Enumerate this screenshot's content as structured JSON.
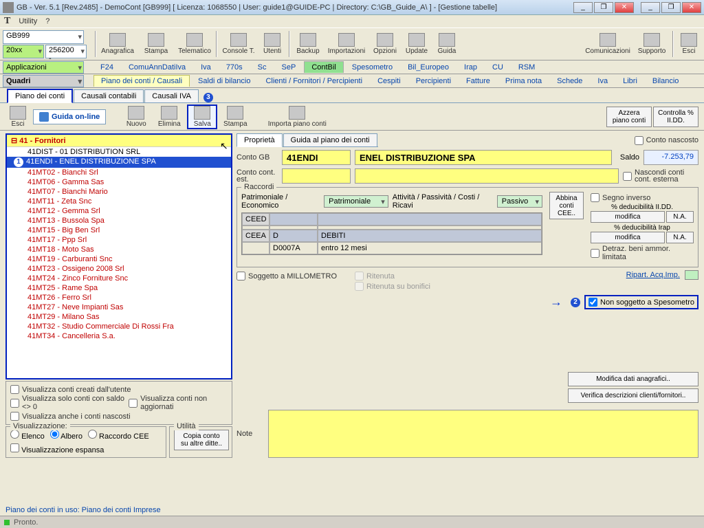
{
  "window": {
    "title": "GB - Ver. 5.1 [Rev.2485] -  DemoCont [GB999]    [ Licenza: 1068550 | User: guide1@GUIDE-PC | Directory: C:\\GB_Guide_A\\ ] - [Gestione tabelle]"
  },
  "menubar": {
    "utility": "Utility",
    "help": "?"
  },
  "leftcombos": {
    "ditta": "GB999",
    "anno": "20xx",
    "code": "256200 -",
    "applicazioni": "Applicazioni",
    "quadri": "Quadri"
  },
  "maintoolbar": {
    "anagrafica": "Anagrafica",
    "stampa": "Stampa",
    "telematico": "Telematico",
    "consolet": "Console T.",
    "utenti": "Utenti",
    "backup": "Backup",
    "importazioni": "Importazioni",
    "opzioni": "Opzioni",
    "update": "Update",
    "guida": "Guida",
    "comunicazioni": "Comunicazioni",
    "supporto": "Supporto",
    "esci": "Esci"
  },
  "tabrow1": {
    "items": [
      "F24",
      "ComuAnnDatiIva",
      "Iva",
      "770s",
      "Sc",
      "SeP",
      "ContBil",
      "Spesometro",
      "Bil_Europeo",
      "Irap",
      "CU",
      "RSM"
    ],
    "active": "ContBil"
  },
  "tabrow2": {
    "lead": "Piano dei conti / Causali",
    "items": [
      "Saldi di bilancio",
      "Clienti / Fornitori / Percipienti",
      "Cespiti",
      "Percipienti",
      "Fatture",
      "Prima nota",
      "Schede",
      "Iva",
      "Libri",
      "Bilancio"
    ]
  },
  "subtabs": {
    "t1": "Piano dei conti",
    "t2": "Causali contabili",
    "t3": "Causali IVA"
  },
  "toolbar2": {
    "esci": "Esci",
    "guida_online": "Guida on-line",
    "nuovo": "Nuovo",
    "elimina": "Elimina",
    "salva": "Salva",
    "stampa": "Stampa",
    "importa": "Importa piano conti",
    "azzera": "Azzera piano conti",
    "controlla": "Controlla % II.DD."
  },
  "tree": {
    "header": "41 - Fornitori",
    "dist": "41DIST - 01 DISTRIBUTION SRL",
    "selected": "41ENDI - ENEL DISTRIBUZIONE SPA",
    "items": [
      "41MT02 - Bianchi Srl",
      "41MT06 - Gamma Sas",
      "41MT07 - Bianchi Mario",
      "41MT11 - Zeta Snc",
      "41MT12 - Gemma Srl",
      "41MT13 - Bussola Spa",
      "41MT15 - Big Ben Srl",
      "41MT17 - Ppp Srl",
      "41MT18 - Moto Sas",
      "41MT19 - Carburanti Snc",
      "41MT23 - Ossigeno 2008 Srl",
      "41MT24 - Zinco Forniture Snc",
      "41MT25 - Rame Spa",
      "41MT26 - Ferro Srl",
      "41MT27 - Neve Impianti Sas",
      "41MT29 - Milano Sas",
      "41MT32 - Studio Commerciale Di Rossi Fra",
      "41MT34 - Cancelleria S.a."
    ]
  },
  "filters": {
    "f1": "Visualizza conti creati dall'utente",
    "f2": "Visualizza solo conti con saldo <> 0",
    "f3": "Visualizza anche i conti nascosti",
    "f4": "Visualizza conti non aggiornati",
    "vis_legend": "Visualizzazione:",
    "util_legend": "Utilità",
    "elenco": "Elenco",
    "albero": "Albero",
    "raccordo": "Raccordo CEE",
    "espansa": "Visualizzazione espansa",
    "copia": "Copia conto su altre ditte.."
  },
  "props": {
    "tab1": "Proprietà",
    "tab2": "Guida al piano dei conti",
    "conto_nascosto": "Conto nascosto",
    "conto_gb_lbl": "Conto GB",
    "conto_gb": "41ENDI",
    "desc": "ENEL DISTRIBUZIONE SPA",
    "saldo_lbl": "Saldo",
    "saldo": "-7.253,79",
    "conto_est_lbl": "Conto cont. est.",
    "nascondi_est": "Nascondi conti cont. esterna",
    "raccordi_legend": "Raccordi",
    "pat_eco_lbl": "Patrimoniale / Economico",
    "pat_eco": "Patrimoniale",
    "apcr_lbl": "Attività / Passività / Costi / Ricavi",
    "apcr": "Passivo",
    "ceed": "CEED",
    "ceea": "CEEA",
    "ceea_code": "D",
    "ceea_desc": "DEBITI",
    "ceea_code2": "D0007A",
    "ceea_desc2": "entro 12 mesi",
    "segno_inv": "Segno inverso",
    "abbina": "Abbina conti CEE..",
    "ded_iidd": "% deducibilità II.DD.",
    "ded_irap": "% deducibilità Irap",
    "modifica": "modifica",
    "na": "N.A.",
    "detraz": "Detraz. beni ammor. limitata",
    "soggetto_mill": "Soggetto a MILLOMETRO",
    "ritenuta": "Ritenuta",
    "ritenuta_bon": "Ritenuta su bonifici",
    "ripart": "Ripart. Acq.Imp.",
    "non_sogg_speso": "Non soggetto a Spesometro",
    "mod_ana": "Modifica dati anagrafici..",
    "ver_desc": "Verifica descrizioni clienti/fornitori..",
    "note_lbl": "Note"
  },
  "statusbar": "Piano dei conti in uso: Piano dei conti Imprese",
  "botstatus": "Pronto."
}
